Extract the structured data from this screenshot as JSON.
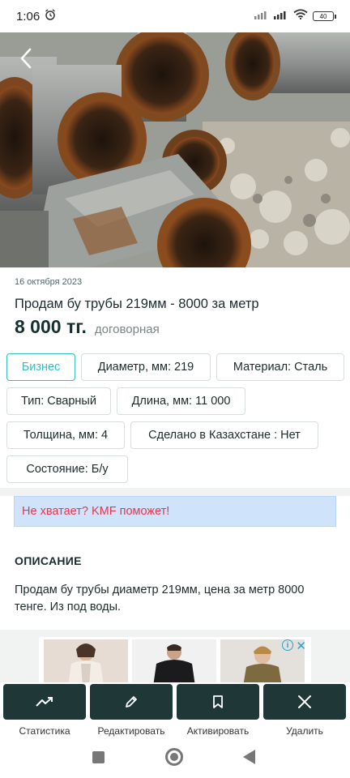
{
  "status_bar": {
    "time": "1:06",
    "battery": "40"
  },
  "listing": {
    "date": "16 октября 2023",
    "title": "Продам бу трубы 219мм - 8000 за метр",
    "price": "8 000 тг.",
    "price_note": "договорная",
    "chips": [
      {
        "label": "Бизнес",
        "highlighted": true
      },
      {
        "label": "Диаметр, мм: 219"
      },
      {
        "label": "Материал: Сталь"
      },
      {
        "label": "Тип: Сварный"
      },
      {
        "label": "Длина, мм: 11 000"
      },
      {
        "label": "Толщина, мм: 4"
      },
      {
        "label": "Сделано в Казахстане : Нет"
      },
      {
        "label": "Состояние: Б/у"
      }
    ],
    "promo": "Не хватает? KMF поможет!",
    "description_heading": "ОПИСАНИЕ",
    "description_text": "Продам бу трубы диаметр 219мм, цена за метр 8000 тенге. Из под воды."
  },
  "ad": {
    "info_icon": "info-icon",
    "close_icon": "close-icon"
  },
  "actions": [
    {
      "label": "Статистика",
      "icon": "trend-icon"
    },
    {
      "label": "Редактировать",
      "icon": "pencil-icon"
    },
    {
      "label": "Активировать",
      "icon": "bookmark-icon"
    },
    {
      "label": "Удалить",
      "icon": "close-icon"
    }
  ],
  "colors": {
    "accent": "#35bcc0",
    "action_bar": "#1f3737",
    "promo_bg": "#cfe4fb",
    "promo_text": "#e4364f"
  }
}
